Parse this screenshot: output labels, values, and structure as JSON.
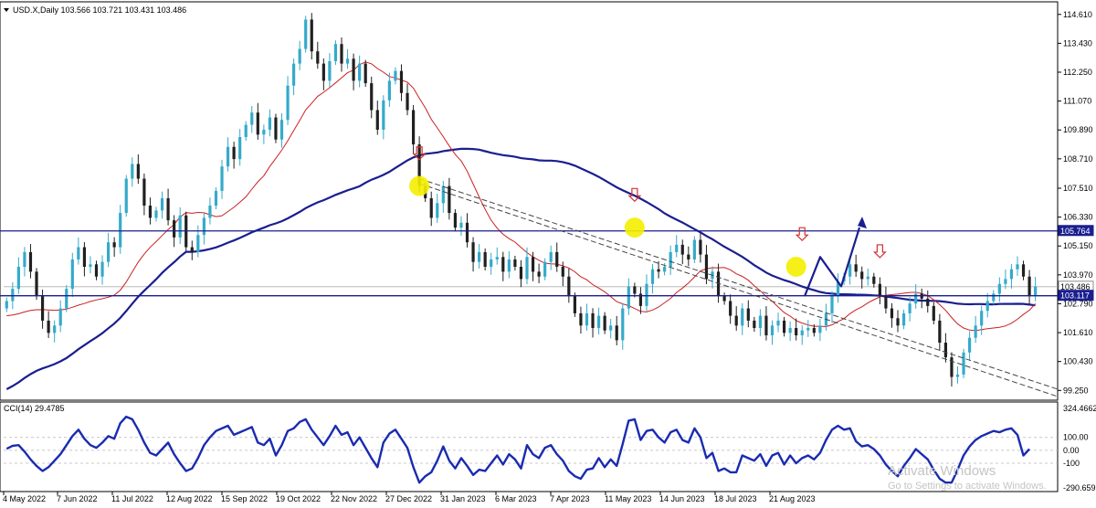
{
  "header": {
    "symbol_line": "USD.X,Daily  103.566 103.721 103.431 103.486",
    "menu_icon": "triangle-down-icon"
  },
  "indicator": {
    "label": "CCI(14) 29.4785"
  },
  "watermark": {
    "title": "Activate Windows",
    "subtitle": "Go to Settings to activate Windows."
  },
  "colors": {
    "bull": "#35aacb",
    "bear": "#202020",
    "ma_long": "#1a1e8f",
    "ma_short": "#cc1f1f",
    "level": "#1a1e8f",
    "arrow": "#d23030",
    "highlight": "#f5ee00",
    "cci": "#1a2bb0"
  },
  "chart_data": [
    {
      "type": "candlestick",
      "title": "USD.X,Daily",
      "ohlc_last": {
        "open": 103.566,
        "high": 103.721,
        "low": 103.431,
        "close": 103.486
      },
      "x_ticks": [
        "4 May 2022",
        "7 Jun 2022",
        "11 Jul 2022",
        "12 Aug 2022",
        "15 Sep 2022",
        "19 Oct 2022",
        "22 Nov 2022",
        "27 Dec 2022",
        "31 Jan 2023",
        "6 Mar 2023",
        "7 Apr 2023",
        "11 May 2023",
        "14 Jun 2023",
        "18 Jul 2023",
        "21 Aug 2023"
      ],
      "y_ticks": [
        114.61,
        113.43,
        112.25,
        111.07,
        109.89,
        108.71,
        107.51,
        106.33,
        105.15,
        103.97,
        102.79,
        101.61,
        100.43,
        99.25
      ],
      "ylim": [
        99.0,
        114.9
      ],
      "price_tags": [
        {
          "value": "105.764",
          "style": "level"
        },
        {
          "value": "103.486",
          "style": "current"
        },
        {
          "value": "103.117",
          "style": "level"
        }
      ],
      "horizontal_levels": [
        105.764,
        103.117
      ],
      "closes": [
        102.9,
        103.4,
        104.3,
        104.9,
        104.1,
        103.1,
        102.1,
        101.6,
        101.9,
        102.6,
        103.4,
        104.6,
        105.1,
        104.3,
        104.4,
        103.9,
        104.5,
        105.3,
        105.1,
        106.5,
        107.9,
        108.5,
        107.9,
        106.8,
        106.3,
        106.6,
        107.1,
        106.2,
        105.5,
        106.4,
        105.1,
        104.9,
        105.6,
        106.3,
        106.8,
        107.4,
        108.4,
        109.2,
        108.7,
        109.6,
        110.1,
        110.6,
        109.7,
        109.9,
        110.4,
        109.5,
        110.3,
        111.7,
        112.6,
        113.2,
        114.4,
        113.1,
        112.6,
        111.9,
        112.7,
        113.4,
        112.6,
        112.8,
        111.9,
        112.6,
        111.8,
        110.7,
        109.9,
        111.1,
        111.9,
        112.3,
        111.4,
        110.7,
        109.3,
        107.6,
        107.1,
        106.3,
        106.9,
        107.6,
        106.5,
        105.9,
        106.1,
        105.3,
        104.5,
        104.9,
        104.3,
        104.6,
        104.7,
        104.1,
        104.6,
        104.3,
        103.8,
        104.7,
        104.1,
        103.9,
        104.5,
        104.9,
        104.3,
        103.9,
        103.1,
        102.4,
        101.9,
        102.4,
        101.8,
        102.3,
        101.7,
        101.9,
        101.3,
        102.6,
        103.5,
        103.2,
        102.7,
        103.6,
        104.2,
        104.1,
        104.3,
        104.9,
        105.2,
        104.8,
        104.6,
        105.4,
        104.8,
        103.8,
        104.1,
        103.1,
        102.9,
        102.3,
        101.9,
        102.6,
        102.1,
        101.8,
        102.3,
        101.5,
        101.9,
        102.1,
        101.6,
        101.8,
        101.5,
        101.7,
        101.8,
        101.6,
        101.9,
        102.4,
        103.1,
        103.7,
        103.9,
        104.4,
        104.1,
        103.8,
        103.9,
        103.6,
        103.1,
        102.6,
        102.2,
        101.9,
        102.4,
        102.8,
        103.2,
        103.0,
        102.7,
        102.1,
        101.2,
        100.6,
        99.8,
        99.9,
        100.8,
        101.4,
        101.9,
        102.5,
        102.9,
        103.2,
        103.6,
        103.8,
        104.2,
        104.4,
        103.9,
        103.1,
        103.5
      ]
    },
    {
      "type": "line",
      "title": "CCI(14)",
      "value_label": "29.4785",
      "y_ticks": [
        "324.4662",
        "100.00",
        "0.00",
        "-100",
        "-290.6597"
      ],
      "ylim": [
        -290.6597,
        324.4662
      ],
      "values": [
        12,
        35,
        40,
        -10,
        -70,
        -120,
        -160,
        -130,
        -80,
        -30,
        40,
        110,
        160,
        90,
        40,
        20,
        60,
        110,
        90,
        210,
        260,
        240,
        160,
        60,
        -20,
        -40,
        10,
        60,
        -30,
        -100,
        -160,
        -140,
        -60,
        40,
        100,
        150,
        170,
        190,
        120,
        140,
        160,
        180,
        60,
        40,
        90,
        -40,
        40,
        150,
        170,
        220,
        240,
        160,
        100,
        40,
        110,
        190,
        120,
        140,
        40,
        100,
        20,
        -60,
        -130,
        60,
        130,
        160,
        90,
        20,
        -130,
        -250,
        -200,
        -170,
        -80,
        30,
        -80,
        -140,
        -60,
        -120,
        -190,
        -150,
        -160,
        -100,
        -40,
        -110,
        -30,
        -70,
        -140,
        40,
        -30,
        -60,
        20,
        40,
        -30,
        -80,
        -160,
        -200,
        -220,
        -150,
        -140,
        -60,
        -130,
        -70,
        -120,
        50,
        230,
        240,
        80,
        150,
        160,
        100,
        60,
        140,
        160,
        80,
        60,
        170,
        100,
        -60,
        -20,
        -160,
        -140,
        -170,
        -170,
        -40,
        -60,
        -80,
        -30,
        -120,
        -40,
        -20,
        -110,
        -40,
        -100,
        -60,
        -40,
        -70,
        -20,
        80,
        160,
        190,
        160,
        170,
        70,
        30,
        40,
        10,
        -40,
        -110,
        -160,
        -200,
        -120,
        -60,
        10,
        -30,
        -70,
        -150,
        -220,
        -250,
        -250,
        -150,
        -40,
        30,
        80,
        110,
        130,
        150,
        140,
        160,
        170,
        120,
        -40,
        10
      ]
    }
  ]
}
